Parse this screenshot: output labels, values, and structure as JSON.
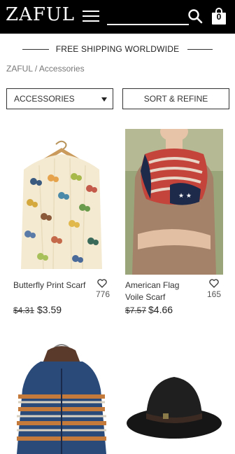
{
  "header": {
    "logo": "ZAFUL",
    "search_placeholder": "",
    "bag_count": "0"
  },
  "banner": {
    "shipping_text": "FREE SHIPPING WORLDWIDE"
  },
  "breadcrumb": {
    "home": "ZAFUL",
    "separator": "/",
    "current": "Accessories"
  },
  "filters": {
    "category_label": "ACCESSORIES",
    "sort_label": "SORT & REFINE"
  },
  "products": [
    {
      "name": "Butterfly Print Scarf",
      "likes": "776",
      "old_price": "$4.31",
      "new_price": "$3.59"
    },
    {
      "name_line1": "American Flag",
      "name_line2": "Voile Scarf",
      "likes": "165",
      "old_price": "$7.57",
      "new_price": "$4.66"
    },
    {
      "name": ""
    },
    {
      "name": ""
    }
  ],
  "icons": [
    "menu-icon",
    "search-icon",
    "bag-icon",
    "heart-icon",
    "caret-down-icon"
  ],
  "colors": {
    "header_bg": "#000000",
    "text": "#333333",
    "muted": "#777777"
  }
}
